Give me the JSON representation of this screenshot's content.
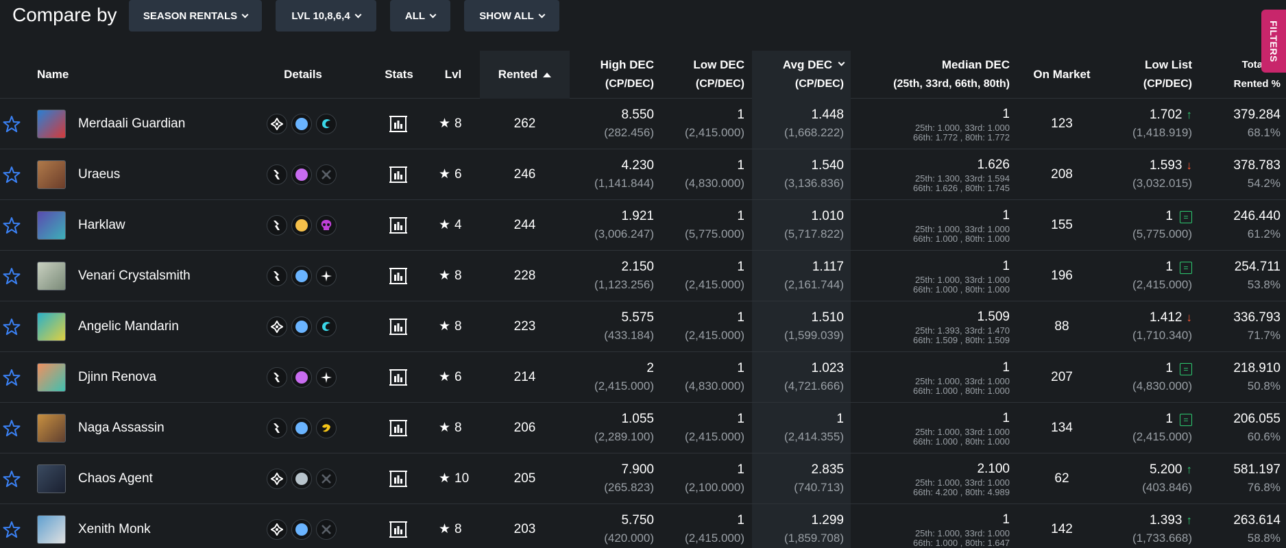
{
  "header": {
    "compare_label": "Compare by",
    "dropdowns": [
      {
        "label": "SEASON RENTALS"
      },
      {
        "label": "LVL 10,8,6,4"
      },
      {
        "label": "ALL"
      },
      {
        "label": "SHOW ALL"
      }
    ],
    "filters_label": "FILTERS"
  },
  "columns": {
    "name": "Name",
    "details": "Details",
    "stats": "Stats",
    "lvl": "Lvl",
    "rented": "Rented",
    "high_dec": "High DEC",
    "high_dec_sub": "(CP/DEC)",
    "low_dec": "Low DEC",
    "low_dec_sub": "(CP/DEC)",
    "avg_dec": "Avg DEC",
    "avg_dec_sub": "(CP/DEC)",
    "median_dec": "Median DEC",
    "median_dec_sub": "(25th, 33rd, 66th, 80th)",
    "on_market": "On Market",
    "low_list": "Low List",
    "low_list_sub": "(CP/DEC)",
    "total_value": "Total Va",
    "total_value_sub": "Rented %"
  },
  "rows": [
    {
      "name": "Merdaali Guardian",
      "lvl": "8",
      "rented": "262",
      "high": "8.550",
      "high_sub": "(282.456)",
      "low": "1",
      "low_sub": "(2,415.000)",
      "avg": "1.448",
      "avg_sub": "(1,668.222)",
      "median": "1",
      "median_l1": "25th: 1.000, 33rd: 1.000",
      "median_l2": "66th: 1.772 , 80th: 1.772",
      "on_market": "123",
      "low_list": "1.702",
      "low_list_trend": "up",
      "low_list_sub": "(1,418.919)",
      "total": "379.284",
      "rented_pct": "68.1%",
      "icons": [
        "neutral-splinter-icon",
        "blue-rarity-dot",
        "water-ability-icon"
      ],
      "rarity_color": "#6ab4ff",
      "thumb_colors": [
        "#2a7fd4",
        "#d43a3a"
      ]
    },
    {
      "name": "Uraeus",
      "lvl": "6",
      "rented": "246",
      "high": "4.230",
      "high_sub": "(1,141.844)",
      "low": "1",
      "low_sub": "(4,830.000)",
      "avg": "1.540",
      "avg_sub": "(3,136.836)",
      "median": "1.626",
      "median_l1": "25th: 1.300, 33rd: 1.594",
      "median_l2": "66th: 1.626 , 80th: 1.745",
      "on_market": "208",
      "low_list": "1.593",
      "low_list_trend": "down",
      "low_list_sub": "(3,032.015)",
      "total": "378.783",
      "rented_pct": "54.2%",
      "icons": [
        "melee-attack-icon",
        "purple-rarity-dot",
        "crossed-swords-icon"
      ],
      "rarity_color": "#c86cf0",
      "thumb_colors": [
        "#b07a4a",
        "#6b3d2a"
      ]
    },
    {
      "name": "Harklaw",
      "lvl": "4",
      "rented": "244",
      "high": "1.921",
      "high_sub": "(3,006.247)",
      "low": "1",
      "low_sub": "(5,775.000)",
      "avg": "1.010",
      "avg_sub": "(5,717.822)",
      "median": "1",
      "median_l1": "25th: 1.000, 33rd: 1.000",
      "median_l2": "66th: 1.000 , 80th: 1.000",
      "on_market": "155",
      "low_list": "1",
      "low_list_trend": "equal",
      "low_list_sub": "(5,775.000)",
      "total": "246.440",
      "rented_pct": "61.2%",
      "icons": [
        "melee-attack-icon",
        "gold-rarity-dot",
        "death-skull-icon"
      ],
      "rarity_color": "#f5c04a",
      "thumb_colors": [
        "#5a4bb0",
        "#3db0b8"
      ]
    },
    {
      "name": "Venari Crystalsmith",
      "lvl": "8",
      "rented": "228",
      "high": "2.150",
      "high_sub": "(1,123.256)",
      "low": "1",
      "low_sub": "(2,415.000)",
      "avg": "1.117",
      "avg_sub": "(2,161.744)",
      "median": "1",
      "median_l1": "25th: 1.000, 33rd: 1.000",
      "median_l2": "66th: 1.000 , 80th: 1.000",
      "on_market": "196",
      "low_list": "1",
      "low_list_trend": "equal",
      "low_list_sub": "(2,415.000)",
      "total": "254.711",
      "rented_pct": "53.8%",
      "icons": [
        "melee-attack-icon",
        "blue-rarity-dot",
        "life-sparkle-icon"
      ],
      "rarity_color": "#6ab4ff",
      "thumb_colors": [
        "#c8d0c0",
        "#7a8a78"
      ]
    },
    {
      "name": "Angelic Mandarin",
      "lvl": "8",
      "rented": "223",
      "high": "5.575",
      "high_sub": "(433.184)",
      "low": "1",
      "low_sub": "(2,415.000)",
      "avg": "1.510",
      "avg_sub": "(1,599.039)",
      "median": "1.509",
      "median_l1": "25th: 1.393, 33rd: 1.470",
      "median_l2": "66th: 1.509 , 80th: 1.509",
      "on_market": "88",
      "low_list": "1.412",
      "low_list_trend": "down",
      "low_list_sub": "(1,710.340)",
      "total": "336.793",
      "rented_pct": "71.7%",
      "icons": [
        "neutral-splinter-icon",
        "blue-rarity-dot",
        "water-ability-icon"
      ],
      "rarity_color": "#6ab4ff",
      "thumb_colors": [
        "#2ab0c8",
        "#e0d040"
      ]
    },
    {
      "name": "Djinn Renova",
      "lvl": "6",
      "rented": "214",
      "high": "2",
      "high_sub": "(2,415.000)",
      "low": "1",
      "low_sub": "(4,830.000)",
      "avg": "1.023",
      "avg_sub": "(4,721.666)",
      "median": "1",
      "median_l1": "25th: 1.000, 33rd: 1.000",
      "median_l2": "66th: 1.000 , 80th: 1.000",
      "on_market": "207",
      "low_list": "1",
      "low_list_trend": "equal",
      "low_list_sub": "(4,830.000)",
      "total": "218.910",
      "rented_pct": "50.8%",
      "icons": [
        "melee-attack-icon",
        "purple-rarity-dot",
        "life-sparkle-icon"
      ],
      "rarity_color": "#c86cf0",
      "thumb_colors": [
        "#f09060",
        "#40c0b0"
      ]
    },
    {
      "name": "Naga Assassin",
      "lvl": "8",
      "rented": "206",
      "high": "1.055",
      "high_sub": "(2,289.100)",
      "low": "1",
      "low_sub": "(2,415.000)",
      "avg": "1",
      "avg_sub": "(2,414.355)",
      "median": "1",
      "median_l1": "25th: 1.000, 33rd: 1.000",
      "median_l2": "66th: 1.000 , 80th: 1.000",
      "on_market": "134",
      "low_list": "1",
      "low_list_trend": "equal",
      "low_list_sub": "(2,415.000)",
      "total": "206.055",
      "rented_pct": "60.6%",
      "icons": [
        "melee-attack-icon",
        "blue-rarity-dot",
        "earth-ability-icon"
      ],
      "rarity_color": "#6ab4ff",
      "thumb_colors": [
        "#c89040",
        "#604030"
      ]
    },
    {
      "name": "Chaos Agent",
      "lvl": "10",
      "rented": "205",
      "high": "7.900",
      "high_sub": "(265.823)",
      "low": "1",
      "low_sub": "(2,100.000)",
      "avg": "2.835",
      "avg_sub": "(740.713)",
      "median": "2.100",
      "median_l1": "25th: 1.000, 33rd: 1.000",
      "median_l2": "66th: 4.200 , 80th: 4.989",
      "on_market": "62",
      "low_list": "5.200",
      "low_list_trend": "up",
      "low_list_sub": "(403.846)",
      "total": "581.197",
      "rented_pct": "76.8%",
      "icons": [
        "neutral-splinter-icon",
        "gray-rarity-dot",
        "crossed-swords-icon"
      ],
      "rarity_color": "#b8c4cc",
      "thumb_colors": [
        "#3a4a60",
        "#1a2030"
      ]
    },
    {
      "name": "Xenith Monk",
      "lvl": "8",
      "rented": "203",
      "high": "5.750",
      "high_sub": "(420.000)",
      "low": "1",
      "low_sub": "(2,415.000)",
      "avg": "1.299",
      "avg_sub": "(1,859.708)",
      "median": "1",
      "median_l1": "25th: 1.000, 33rd: 1.000",
      "median_l2": "66th: 1.000 , 80th: 1.647",
      "on_market": "142",
      "low_list": "1.393",
      "low_list_trend": "up",
      "low_list_sub": "(1,733.668)",
      "total": "263.614",
      "rented_pct": "58.8%",
      "icons": [
        "neutral-splinter-icon",
        "blue-rarity-dot",
        "crossed-swords-icon"
      ],
      "rarity_color": "#6ab4ff",
      "thumb_colors": [
        "#60a0d0",
        "#e0e0e0"
      ]
    }
  ],
  "colors": {
    "background": "#1a1d20",
    "dropdown_bg": "#2b3541",
    "filters_tab": "#c8266b",
    "trend_up": "#2ecc71",
    "trend_down": "#ff5a36",
    "star_outline": "#3b82f6"
  }
}
